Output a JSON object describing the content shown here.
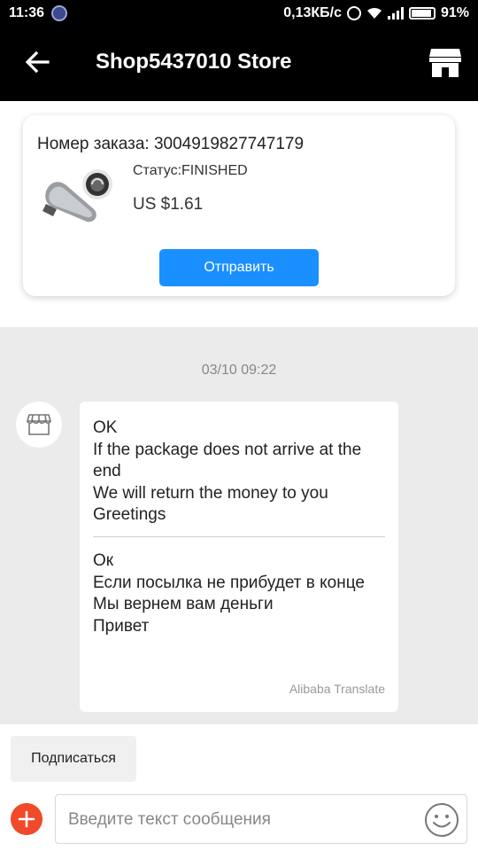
{
  "status_bar": {
    "time": "11:36",
    "network_speed": "0,13КБ/с",
    "battery": "91%"
  },
  "header": {
    "title": "Shop5437010 Store",
    "back_icon": "arrow-left-icon",
    "store_icon": "store-icon"
  },
  "order": {
    "number_label": "Номер заказа: 3004919827747179",
    "status": "Статус:FINISHED",
    "price": "US $1.61",
    "send_label": "Отправить"
  },
  "chat": {
    "timestamp": "03/10 09:22",
    "message": {
      "original": "OK\nIf the package does not arrive at the end\nWe will return the money to you\nGreetings",
      "translated": "Ок\nЕсли посылка не прибудет в конце\nМы вернем вам деньги\nПривет",
      "translator": "Alibaba Translate"
    }
  },
  "actions": {
    "subscribe_label": "Подписаться"
  },
  "composer": {
    "placeholder": "Введите текст сообщения",
    "value": ""
  },
  "colors": {
    "accent": "#1a8fff",
    "header_bg": "#000000",
    "chat_bg": "#ebebeb",
    "plus_button": "#f04a2a"
  }
}
